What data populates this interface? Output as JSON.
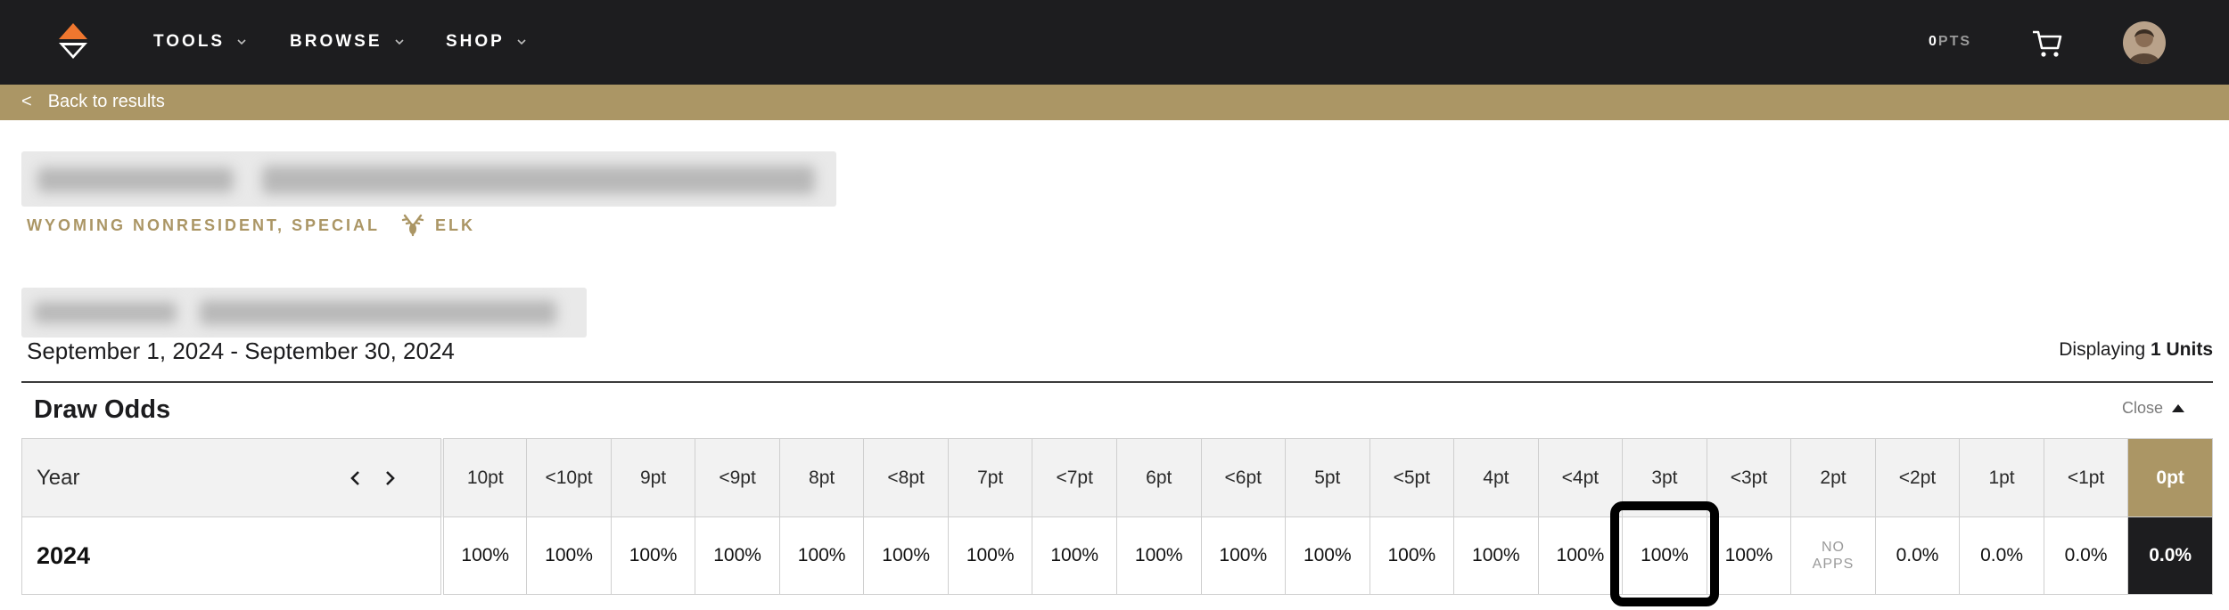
{
  "nav": {
    "items": [
      {
        "label": "TOOLS"
      },
      {
        "label": "BROWSE"
      },
      {
        "label": "SHOP"
      }
    ],
    "points_value": "0",
    "points_unit": "PTS",
    "icons": [
      "logo-icon",
      "chevron-down-icon",
      "cart-icon",
      "avatar"
    ]
  },
  "back": {
    "arrow": "<",
    "label": "Back to results"
  },
  "hunt": {
    "subtitle": "WYOMING NONRESIDENT, SPECIAL",
    "species": "ELK",
    "dates": "September 1, 2024 - September 30, 2024",
    "displaying_prefix": "Displaying",
    "displaying_count": "1 Units"
  },
  "draw_odds": {
    "title": "Draw Odds",
    "close_label": "Close",
    "year_header": "Year",
    "columns": [
      "10pt",
      "<10pt",
      "9pt",
      "<9pt",
      "8pt",
      "<8pt",
      "7pt",
      "<7pt",
      "6pt",
      "<6pt",
      "5pt",
      "<5pt",
      "4pt",
      "<4pt",
      "3pt",
      "<3pt",
      "2pt",
      "<2pt",
      "1pt",
      "<1pt",
      "0pt"
    ],
    "rows": [
      {
        "year": "2024",
        "values": [
          "100%",
          "100%",
          "100%",
          "100%",
          "100%",
          "100%",
          "100%",
          "100%",
          "100%",
          "100%",
          "100%",
          "100%",
          "100%",
          "100%",
          "100%",
          "100%",
          "NO APPS",
          "0.0%",
          "0.0%",
          "0.0%",
          "0.0%"
        ]
      }
    ],
    "highlighted_column": "3pt"
  },
  "colors": {
    "nav_bg": "#1d1d1f",
    "accent_gold": "#ab9665",
    "logo_orange": "#f0772f"
  }
}
